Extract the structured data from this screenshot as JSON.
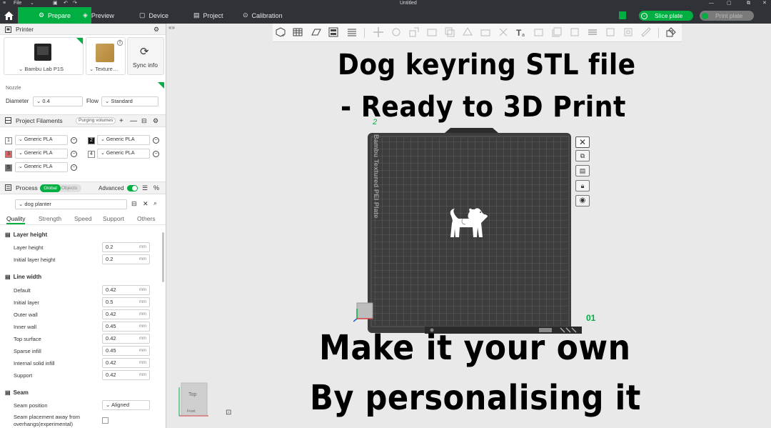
{
  "window": {
    "title": "Untitled",
    "file_menu": "File"
  },
  "tabs": [
    {
      "label": "Prepare",
      "active": true
    },
    {
      "label": "Preview"
    },
    {
      "label": "Device"
    },
    {
      "label": "Project"
    },
    {
      "label": "Calibration"
    }
  ],
  "actions": {
    "slice": "Slice plate",
    "print": "Print plate"
  },
  "printer": {
    "section": "Printer",
    "model": "Bambu Lab P1S",
    "plate": "Texture…",
    "sync": "Sync info",
    "nozzle_label": "Nozzle",
    "diameter_label": "Diameter",
    "diameter": "0.4",
    "flow_label": "Flow",
    "flow": "Standard"
  },
  "filaments": {
    "section": "Project Filaments",
    "purge": "Purging volumes",
    "items": [
      {
        "num": "1",
        "name": "Generic PLA",
        "color": "#ffffff"
      },
      {
        "num": "2",
        "name": "Generic PLA",
        "color": "#111111"
      },
      {
        "num": "3",
        "name": "Generic PLA",
        "color": "#e06666"
      },
      {
        "num": "4",
        "name": "Generic PLA",
        "color": "#ffffff"
      },
      {
        "num": "5",
        "name": "Generic PLA",
        "color": "#707070"
      }
    ]
  },
  "process": {
    "section": "Process",
    "global": "Global",
    "objects": "Objects",
    "advanced": "Advanced",
    "preset": "dog planter",
    "tabs": [
      "Quality",
      "Strength",
      "Speed",
      "Support",
      "Others"
    ],
    "layer_height_group": "Layer height",
    "layer_height": [
      {
        "label": "Layer height",
        "value": "0.2",
        "unit": "mm"
      },
      {
        "label": "Initial layer height",
        "value": "0.2",
        "unit": "mm"
      }
    ],
    "line_width_group": "Line width",
    "line_width": [
      {
        "label": "Default",
        "value": "0.42",
        "unit": "mm"
      },
      {
        "label": "Initial layer",
        "value": "0.5",
        "unit": "mm"
      },
      {
        "label": "Outer wall",
        "value": "0.42",
        "unit": "mm"
      },
      {
        "label": "Inner wall",
        "value": "0.45",
        "unit": "mm"
      },
      {
        "label": "Top surface",
        "value": "0.42",
        "unit": "mm"
      },
      {
        "label": "Sparse infill",
        "value": "0.45",
        "unit": "mm"
      },
      {
        "label": "Internal solid infill",
        "value": "0.42",
        "unit": "mm"
      },
      {
        "label": "Support",
        "value": "0.42",
        "unit": "mm"
      }
    ],
    "seam_group": "Seam",
    "seam_position_label": "Seam position",
    "seam_position": "Aligned",
    "seam_away_label_1": "Seam placement away from",
    "seam_away_label_2": "overhangs(experimental)"
  },
  "viewport": {
    "plate_label": "Bambu Textured PEI Plate",
    "plate_number": "01",
    "object_tag": "2",
    "view_cube_top": "Top",
    "view_cube_front": "Front"
  },
  "overlay": {
    "line1": "Dog keyring STL file",
    "line2": "- Ready to 3D Print",
    "line3": "Make it your own",
    "line4": "By personalising it"
  }
}
